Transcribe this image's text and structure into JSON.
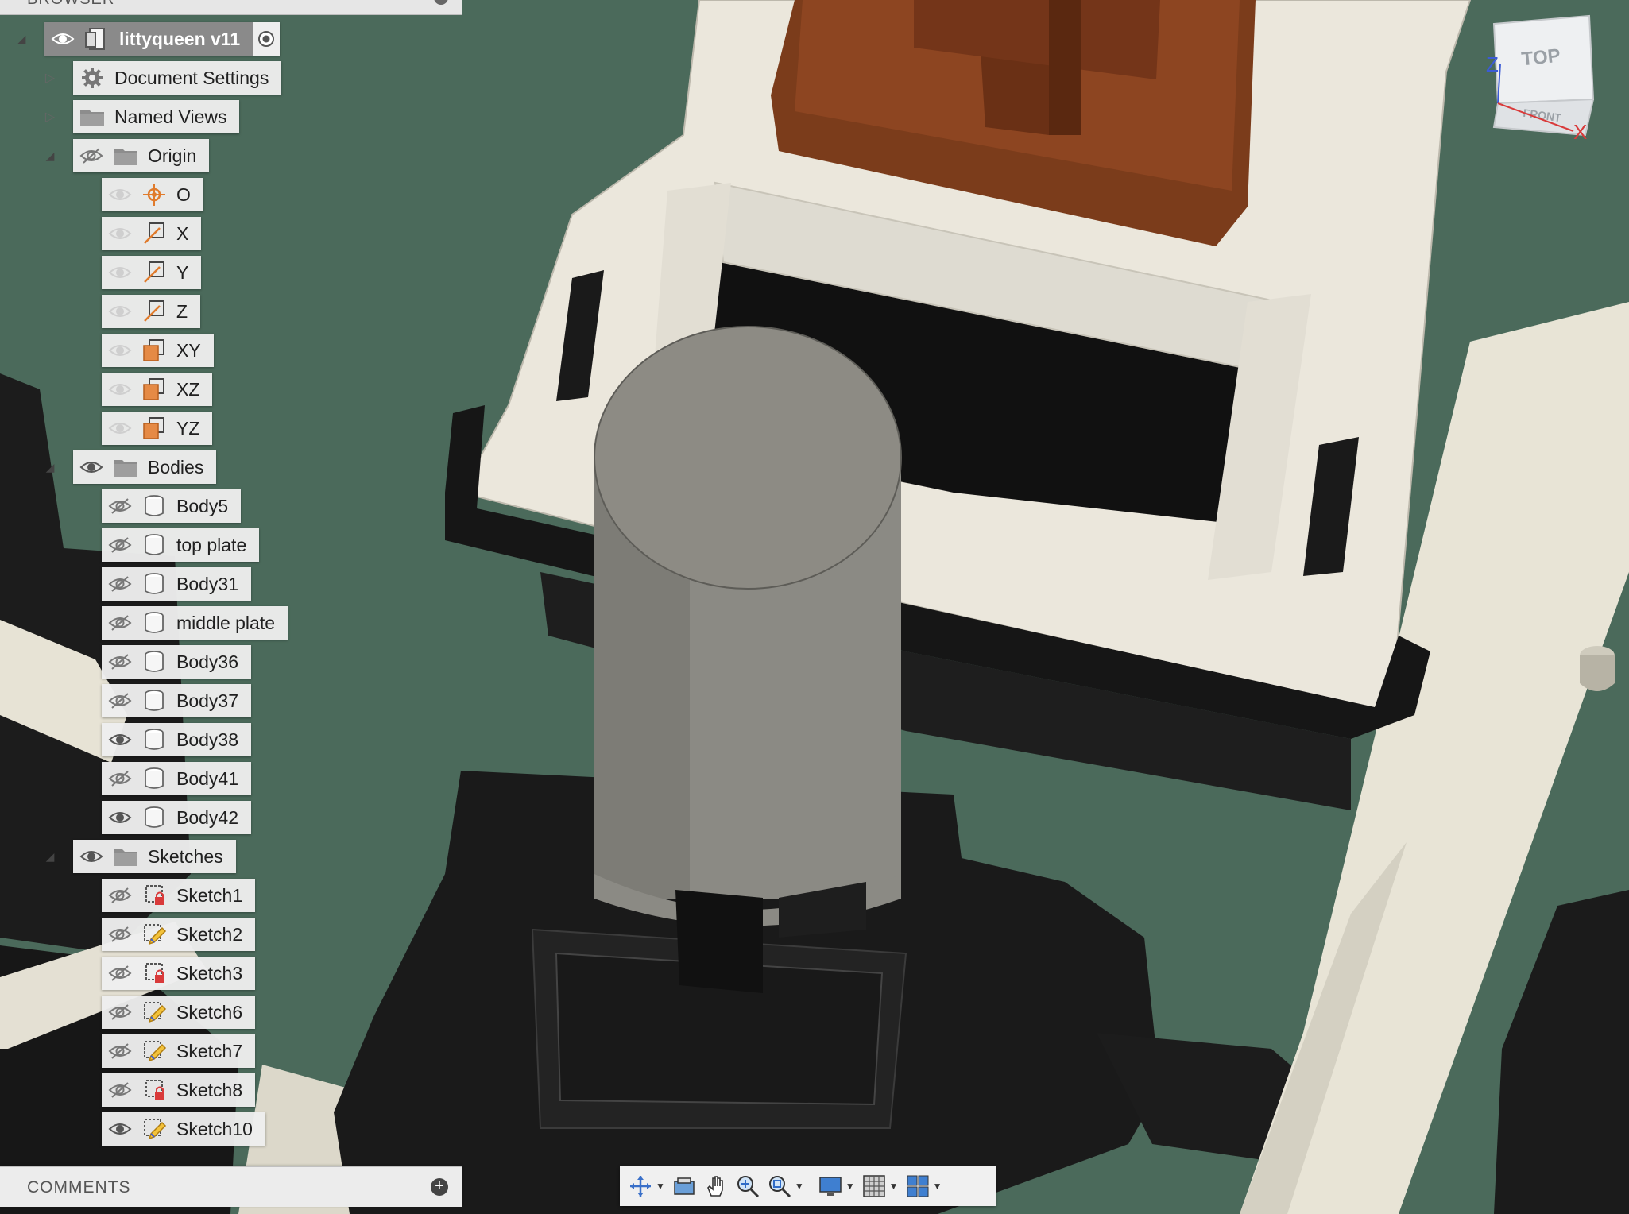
{
  "panel": {
    "title": "BROWSER"
  },
  "root": {
    "label": "littyqueen v11"
  },
  "tree": {
    "document_settings": "Document Settings",
    "named_views": "Named Views",
    "origin": {
      "label": "Origin",
      "items": [
        "O",
        "X",
        "Y",
        "Z",
        "XY",
        "XZ",
        "YZ"
      ]
    },
    "bodies": {
      "label": "Bodies",
      "items": [
        "Body5",
        "top plate",
        "Body31",
        "middle plate",
        "Body36",
        "Body37",
        "Body38",
        "Body41",
        "Body42"
      ],
      "visible": [
        false,
        false,
        false,
        false,
        false,
        false,
        true,
        false,
        true
      ]
    },
    "sketches": {
      "label": "Sketches",
      "items": [
        "Sketch1",
        "Sketch2",
        "Sketch3",
        "Sketch6",
        "Sketch7",
        "Sketch8",
        "Sketch10"
      ],
      "visible": [
        false,
        false,
        false,
        false,
        false,
        false,
        true
      ]
    }
  },
  "comments": {
    "label": "COMMENTS"
  },
  "viewcube": {
    "top": "TOP",
    "front": "FRONT",
    "axis_z": "Z",
    "axis_x": "X"
  },
  "colors": {
    "background_green": "#4c6b5c",
    "plate_cream": "#e9e5da",
    "switch_black": "#1b1b1b",
    "stem_brown": "#7a3a1a",
    "cylinder_gray": "#8c8b85",
    "axis_red": "#d93a3a",
    "axis_blue": "#3b5bd6",
    "origin_orange": "#e07b2c"
  },
  "navbar": {
    "icons": [
      "orbit-icon",
      "look-at-icon",
      "pan-icon",
      "zoom-icon",
      "fit-icon",
      "display-settings-icon",
      "grid-icon",
      "viewports-icon"
    ]
  }
}
